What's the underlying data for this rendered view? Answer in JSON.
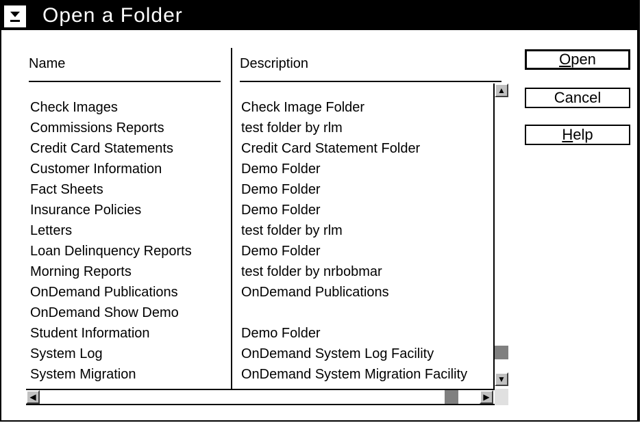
{
  "window": {
    "title": "Open a Folder"
  },
  "columns": {
    "name": "Name",
    "description": "Description"
  },
  "folders": [
    {
      "name": "Check Images",
      "description": "Check Image Folder"
    },
    {
      "name": "Commissions Reports",
      "description": "test folder by rlm"
    },
    {
      "name": "Credit Card Statements",
      "description": "Credit Card Statement Folder"
    },
    {
      "name": "Customer Information",
      "description": "Demo Folder"
    },
    {
      "name": "Fact Sheets",
      "description": "Demo Folder"
    },
    {
      "name": "Insurance Policies",
      "description": "Demo Folder"
    },
    {
      "name": "Letters",
      "description": "test folder by rlm"
    },
    {
      "name": "Loan Delinquency Reports",
      "description": "Demo Folder"
    },
    {
      "name": "Morning Reports",
      "description": "test folder by nrbobmar"
    },
    {
      "name": "OnDemand Publications",
      "description": "OnDemand Publications"
    },
    {
      "name": "OnDemand Show Demo",
      "description": ""
    },
    {
      "name": "Student Information",
      "description": "Demo Folder"
    },
    {
      "name": "System Log",
      "description": "OnDemand System Log Facility"
    },
    {
      "name": "System Migration",
      "description": "OnDemand System Migration Facility"
    }
  ],
  "buttons": {
    "open": {
      "pre": "",
      "mnemonic": "O",
      "post": "pen"
    },
    "cancel": {
      "label": "Cancel"
    },
    "help": {
      "pre": "",
      "mnemonic": "H",
      "post": "elp"
    }
  },
  "scroll": {
    "vertical_position": 0.95,
    "horizontal_position": 0.95
  },
  "icons": {
    "system_menu": "system-menu-icon",
    "scroll_up": "up-arrow-icon",
    "scroll_down": "down-arrow-icon",
    "scroll_left": "left-arrow-icon",
    "scroll_right": "right-arrow-icon"
  }
}
